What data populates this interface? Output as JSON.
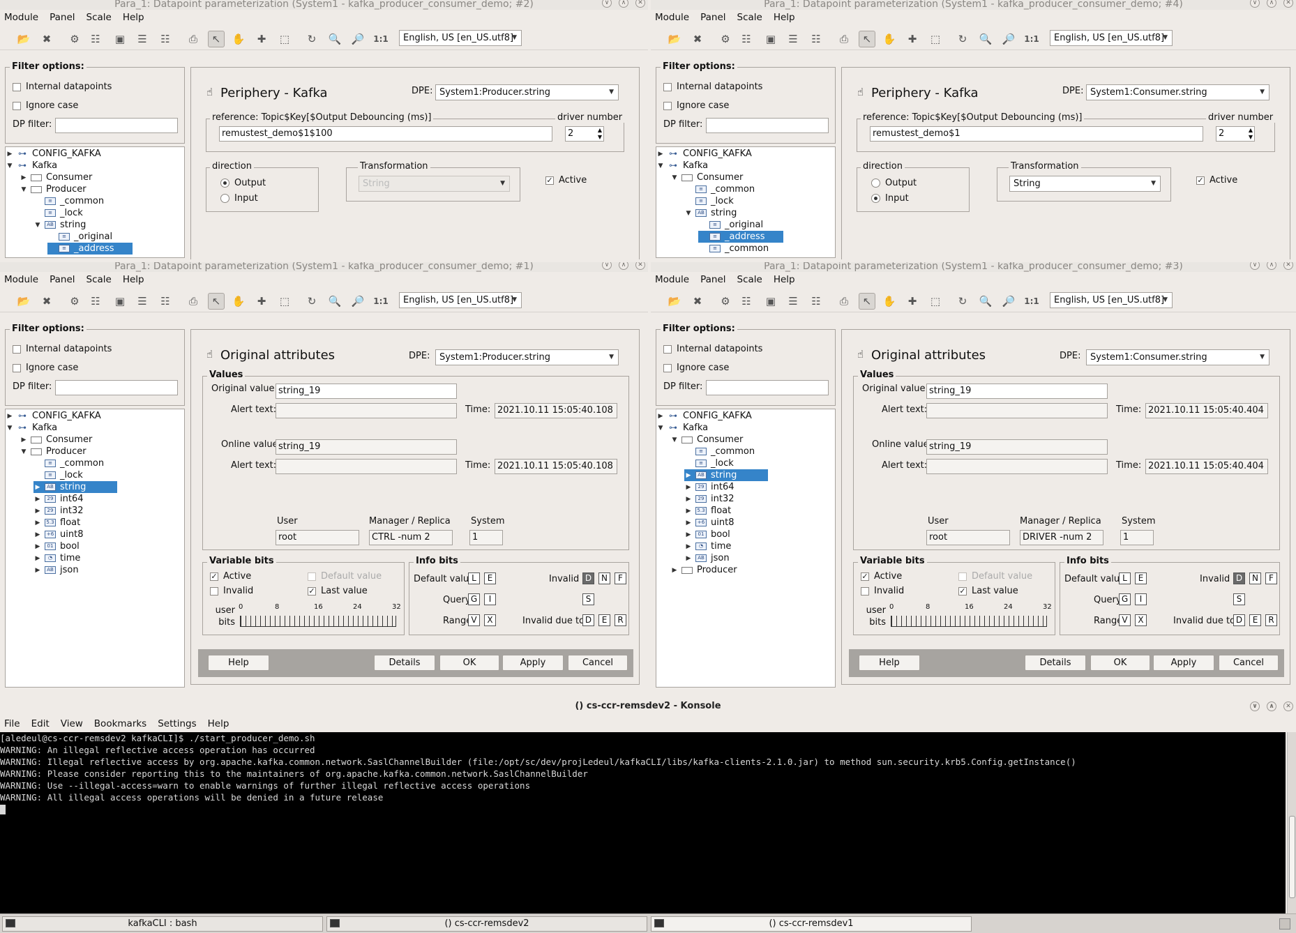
{
  "menu": [
    "Module",
    "Panel",
    "Scale",
    "Help"
  ],
  "language": "English, US [en_US.utf8]",
  "filter": {
    "title": "Filter options:",
    "internal": "Internal datapoints",
    "ignore_case": "Ignore case",
    "dp_filter": "DP filter:"
  },
  "windows": {
    "w2": {
      "title": "Para_1: Datapoint parameterization (System1 - kafka_producer_consumer_demo; #2)",
      "panel_title": "Periphery - Kafka",
      "dpe_label": "DPE:",
      "dpe": "System1:Producer.string",
      "reference_label": "reference: Topic$Key[$Output Debouncing (ms)]",
      "reference": "remustest_demo$1$100",
      "driver_label": "driver number",
      "driver": "2",
      "direction_label": "direction",
      "output": "Output",
      "input": "Input",
      "transformation_label": "Transformation",
      "transformation": "String",
      "active": "Active",
      "tree": [
        "CONFIG_KAFKA",
        "Kafka",
        "Consumer",
        "Producer",
        "_common",
        "_lock",
        "string",
        "_original",
        "_address"
      ]
    },
    "w4": {
      "title": "Para_1: Datapoint parameterization (System1 - kafka_producer_consumer_demo; #4)",
      "panel_title": "Periphery - Kafka",
      "dpe_label": "DPE:",
      "dpe": "System1:Consumer.string",
      "reference_label": "reference: Topic$Key[$Output Debouncing (ms)]",
      "reference": "remustest_demo$1",
      "driver_label": "driver number",
      "driver": "2",
      "direction_label": "direction",
      "output": "Output",
      "input": "Input",
      "transformation_label": "Transformation",
      "transformation": "String",
      "active": "Active",
      "tree": [
        "CONFIG_KAFKA",
        "Kafka",
        "Consumer",
        "_common",
        "_lock",
        "string",
        "_original",
        "_address",
        "_common"
      ]
    },
    "w1": {
      "title": "Para_1: Datapoint parameterization (System1 - kafka_producer_consumer_demo; #1)",
      "panel_title": "Original attributes",
      "dpe_label": "DPE:",
      "dpe": "System1:Producer.string",
      "values_label": "Values",
      "original_value_label": "Original value:",
      "original_value": "string_19",
      "alert_text_label": "Alert text:",
      "time_label": "Time:",
      "time1": "2021.10.11 15:05:40.108",
      "online_value_label": "Online value",
      "online_value": "string_19",
      "time2": "2021.10.11 15:05:40.108",
      "user_label": "User",
      "user": "root",
      "manager_label": "Manager / Replica",
      "manager": "CTRL -num 2",
      "system_label": "System",
      "system": "1",
      "tree": [
        "CONFIG_KAFKA",
        "Kafka",
        "Consumer",
        "Producer",
        "_common",
        "_lock",
        "string",
        "int64",
        "int32",
        "float",
        "uint8",
        "bool",
        "time",
        "json"
      ]
    },
    "w3": {
      "title": "Para_1: Datapoint parameterization (System1 - kafka_producer_consumer_demo; #3)",
      "panel_title": "Original attributes",
      "dpe_label": "DPE:",
      "dpe": "System1:Consumer.string",
      "values_label": "Values",
      "original_value_label": "Original value:",
      "original_value": "string_19",
      "alert_text_label": "Alert text:",
      "time_label": "Time:",
      "time1": "2021.10.11 15:05:40.404",
      "online_value_label": "Online value",
      "online_value": "string_19",
      "time2": "2021.10.11 15:05:40.404",
      "user_label": "User",
      "user": "root",
      "manager_label": "Manager / Replica",
      "manager": "DRIVER -num 2",
      "system_label": "System",
      "system": "1",
      "tree": [
        "CONFIG_KAFKA",
        "Kafka",
        "Consumer",
        "_common",
        "_lock",
        "string",
        "int64",
        "int32",
        "float",
        "uint8",
        "bool",
        "time",
        "json",
        "Producer"
      ]
    }
  },
  "bits": {
    "variable_bits": "Variable bits",
    "active": "Active",
    "default_value": "Default value",
    "invalid": "Invalid",
    "last_value": "Last value",
    "user_bits": "user bits",
    "ticks": [
      "0",
      "8",
      "16",
      "24",
      "32"
    ],
    "info_bits": "Info bits",
    "default_value_lbl": "Default value",
    "invalid_lbl": "Invalid",
    "query": "Query",
    "range": "Range",
    "invalid_due_to": "Invalid due to",
    "letters": {
      "L": "L",
      "E": "E",
      "D": "D",
      "N": "N",
      "F": "F",
      "G": "G",
      "I": "I",
      "S": "S",
      "V": "V",
      "X": "X",
      "R": "R"
    }
  },
  "buttons": {
    "help": "Help",
    "details": "Details",
    "ok": "OK",
    "apply": "Apply",
    "cancel": "Cancel"
  },
  "konsole": {
    "title": "() cs-ccr-remsdev2 - Konsole",
    "menu": [
      "File",
      "Edit",
      "View",
      "Bookmarks",
      "Settings",
      "Help"
    ],
    "lines": [
      "[aledeul@cs-ccr-remsdev2 kafkaCLI]$ ./start_producer_demo.sh",
      "WARNING: An illegal reflective access operation has occurred",
      "WARNING: Illegal reflective access by org.apache.kafka.common.network.SaslChannelBuilder (file:/opt/sc/dev/projLedeul/kafkaCLI/libs/kafka-clients-2.1.0.jar) to method sun.security.krb5.Config.getInstance()",
      "WARNING: Please consider reporting this to the maintainers of org.apache.kafka.common.network.SaslChannelBuilder",
      "WARNING: Use --illegal-access=warn to enable warnings of further illegal reflective access operations",
      "WARNING: All illegal access operations will be denied in a future release"
    ]
  },
  "taskbar": [
    "kafkaCLI : bash",
    "() cs-ccr-remsdev2",
    "() cs-ccr-remsdev1"
  ]
}
